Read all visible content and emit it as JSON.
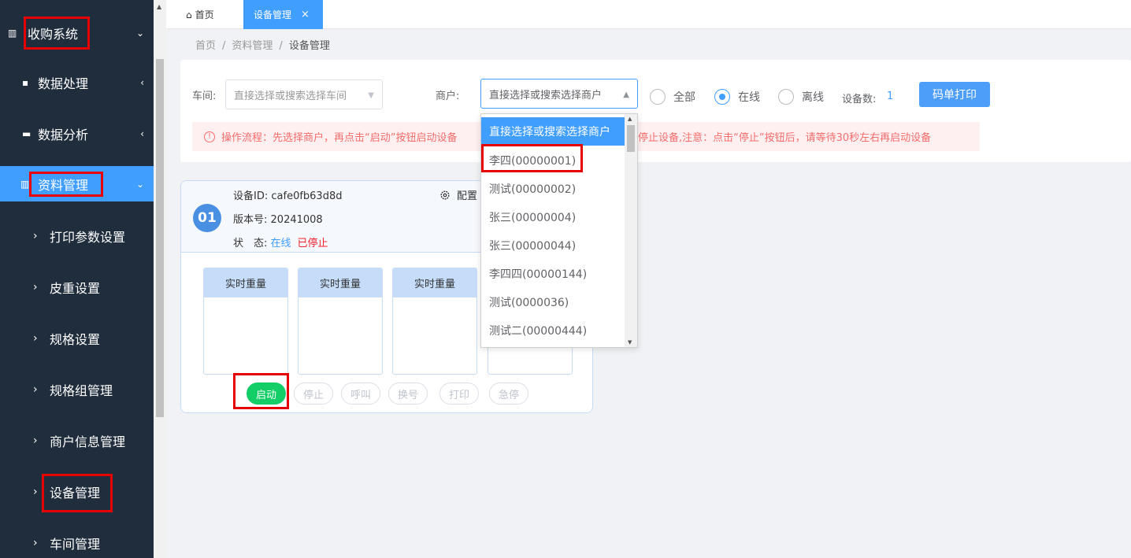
{
  "sidebar": {
    "items": [
      {
        "label": "收购系统",
        "icon": "book-icon",
        "chevron": "⌄"
      },
      {
        "label": "数据处理",
        "icon": "file-icon",
        "chevron": "‹"
      },
      {
        "label": "数据分析",
        "icon": "monitor-icon",
        "chevron": "‹"
      },
      {
        "label": "资料管理",
        "icon": "book-open-icon",
        "chevron": "⌄"
      }
    ],
    "subitems": [
      "打印参数设置",
      "皮重设置",
      "规格设置",
      "规格组管理",
      "商户信息管理",
      "设备管理",
      "车间管理"
    ]
  },
  "tabs": [
    {
      "label": "首页",
      "icon": "home-icon"
    },
    {
      "label": "设备管理",
      "close": "×"
    }
  ],
  "breadcrumb": [
    "首页",
    "资料管理",
    "设备管理"
  ],
  "filters": {
    "workshop_label": "车间:",
    "workshop_placeholder": "直接选择或搜索选择车间",
    "merchant_label": "商户:",
    "merchant_placeholder": "直接选择或搜索选择商户",
    "radios": [
      {
        "label": "全部",
        "checked": false
      },
      {
        "label": "在线",
        "checked": true
      },
      {
        "label": "离线",
        "checked": false
      }
    ],
    "device_count_label": "设备数:",
    "device_count": "1",
    "print_button": "码单打印"
  },
  "alert": {
    "icon": "!",
    "text_left": "操作流程：先选择商户，再点击“启动”按钮启动设备",
    "text_right": "停止设备,注意：点击“停止”按钮后，请等待30秒左右再启动设备"
  },
  "merchant_dropdown": {
    "options": [
      "直接选择或搜索选择商户",
      "李四(00000001)",
      "测试(00000002)",
      "张三(00000004)",
      "张三(00000044)",
      "李四四(00000144)",
      "测试(0000036)",
      "测试二(00000444)"
    ],
    "highlighted_index": 0
  },
  "device_card": {
    "number": "01",
    "device_id_label": "设备ID:",
    "device_id": "cafe0fb63d8d",
    "version_label": "版本号:",
    "version": "20241008",
    "status_label": "状　态:",
    "status_online": "在线",
    "status_stopped": "已停止",
    "config_label": "配置",
    "weight_boxes": [
      "实时重量",
      "实时重量",
      "实时重量",
      ""
    ],
    "buttons": [
      "启动",
      "停止",
      "呼叫",
      "换号",
      "打印",
      "急停"
    ]
  },
  "colors": {
    "sidebar_bg": "#1f2d3d",
    "accent": "#409eff",
    "start_green": "#13ce66",
    "alert_red": "#f56c6c",
    "highlight_red": "#e60000"
  }
}
